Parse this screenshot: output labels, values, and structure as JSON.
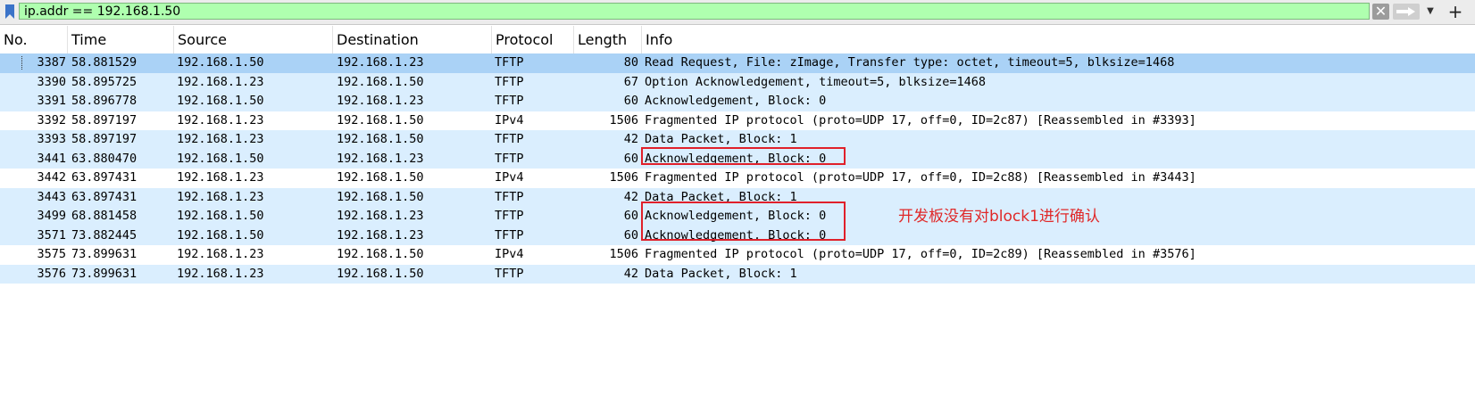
{
  "filter": {
    "value": "ip.addr == 192.168.1.50",
    "filter_color": "#afffaf"
  },
  "columns": [
    "No.",
    "Time",
    "Source",
    "Destination",
    "Protocol",
    "Length",
    "Info"
  ],
  "colors": {
    "tftp_row": "#daeefe",
    "selected_row": "#aad2f6",
    "ipv4_row": "#ffffff",
    "annotation": "#e02828"
  },
  "packets": [
    {
      "no": "3387",
      "time": "58.881529",
      "src": "192.168.1.50",
      "dst": "192.168.1.23",
      "proto": "TFTP",
      "len": "80",
      "info": "Read Request, File: zImage, Transfer type: octet, timeout=5, blksize=1468",
      "selected": true
    },
    {
      "no": "3390",
      "time": "58.895725",
      "src": "192.168.1.23",
      "dst": "192.168.1.50",
      "proto": "TFTP",
      "len": "67",
      "info": "Option Acknowledgement, timeout=5, blksize=1468"
    },
    {
      "no": "3391",
      "time": "58.896778",
      "src": "192.168.1.50",
      "dst": "192.168.1.23",
      "proto": "TFTP",
      "len": "60",
      "info": "Acknowledgement, Block: 0"
    },
    {
      "no": "3392",
      "time": "58.897197",
      "src": "192.168.1.23",
      "dst": "192.168.1.50",
      "proto": "IPv4",
      "len": "1506",
      "info": "Fragmented IP protocol (proto=UDP 17, off=0, ID=2c87) [Reassembled in #3393]"
    },
    {
      "no": "3393",
      "time": "58.897197",
      "src": "192.168.1.23",
      "dst": "192.168.1.50",
      "proto": "TFTP",
      "len": "42",
      "info": "Data Packet, Block: 1"
    },
    {
      "no": "3441",
      "time": "63.880470",
      "src": "192.168.1.50",
      "dst": "192.168.1.23",
      "proto": "TFTP",
      "len": "60",
      "info": "Acknowledgement, Block: 0"
    },
    {
      "no": "3442",
      "time": "63.897431",
      "src": "192.168.1.23",
      "dst": "192.168.1.50",
      "proto": "IPv4",
      "len": "1506",
      "info": "Fragmented IP protocol (proto=UDP 17, off=0, ID=2c88) [Reassembled in #3443]"
    },
    {
      "no": "3443",
      "time": "63.897431",
      "src": "192.168.1.23",
      "dst": "192.168.1.50",
      "proto": "TFTP",
      "len": "42",
      "info": "Data Packet, Block: 1"
    },
    {
      "no": "3499",
      "time": "68.881458",
      "src": "192.168.1.50",
      "dst": "192.168.1.23",
      "proto": "TFTP",
      "len": "60",
      "info": "Acknowledgement, Block: 0"
    },
    {
      "no": "3571",
      "time": "73.882445",
      "src": "192.168.1.50",
      "dst": "192.168.1.23",
      "proto": "TFTP",
      "len": "60",
      "info": "Acknowledgement, Block: 0"
    },
    {
      "no": "3575",
      "time": "73.899631",
      "src": "192.168.1.23",
      "dst": "192.168.1.50",
      "proto": "IPv4",
      "len": "1506",
      "info": "Fragmented IP protocol (proto=UDP 17, off=0, ID=2c89) [Reassembled in #3576]"
    },
    {
      "no": "3576",
      "time": "73.899631",
      "src": "192.168.1.23",
      "dst": "192.168.1.50",
      "proto": "TFTP",
      "len": "42",
      "info": "Data Packet, Block: 1"
    }
  ],
  "annotation": {
    "text": "开发板没有对block1进行确认"
  }
}
